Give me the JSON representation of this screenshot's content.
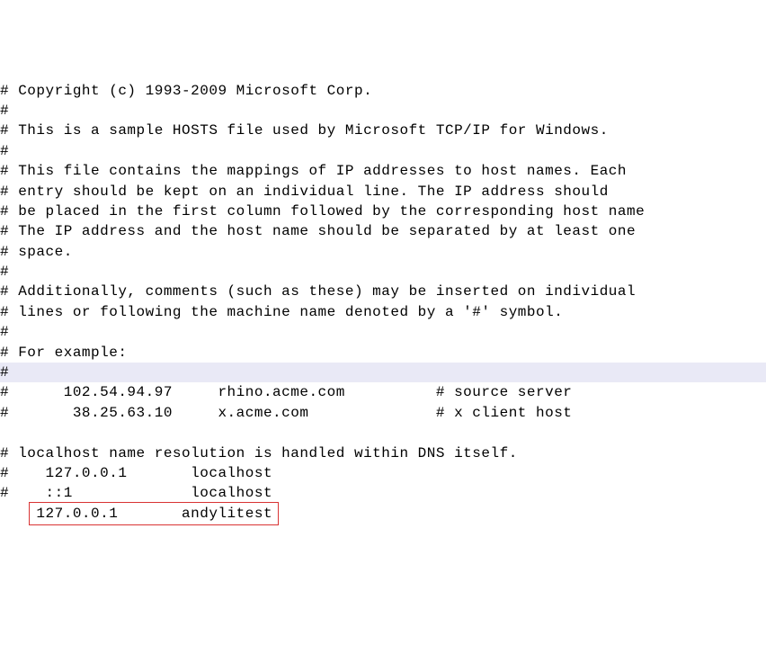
{
  "lines": [
    "# Copyright (c) 1993-2009 Microsoft Corp.",
    "#",
    "# This is a sample HOSTS file used by Microsoft TCP/IP for Windows.",
    "#",
    "# This file contains the mappings of IP addresses to host names. Each",
    "# entry should be kept on an individual line. The IP address should",
    "# be placed in the first column followed by the corresponding host name",
    "# The IP address and the host name should be separated by at least one",
    "# space.",
    "#",
    "# Additionally, comments (such as these) may be inserted on individual",
    "# lines or following the machine name denoted by a '#' symbol.",
    "#",
    "# For example:",
    "#",
    "#      102.54.94.97     rhino.acme.com          # source server",
    "#       38.25.63.10     x.acme.com              # x client host",
    "",
    "# localhost name resolution is handled within DNS itself.",
    "#\t127.0.0.1       localhost",
    "#\t::1             localhost",
    "\t127.0.0.1       andylitest"
  ],
  "current_line_index": 14,
  "highlight_box_line_index": 21
}
